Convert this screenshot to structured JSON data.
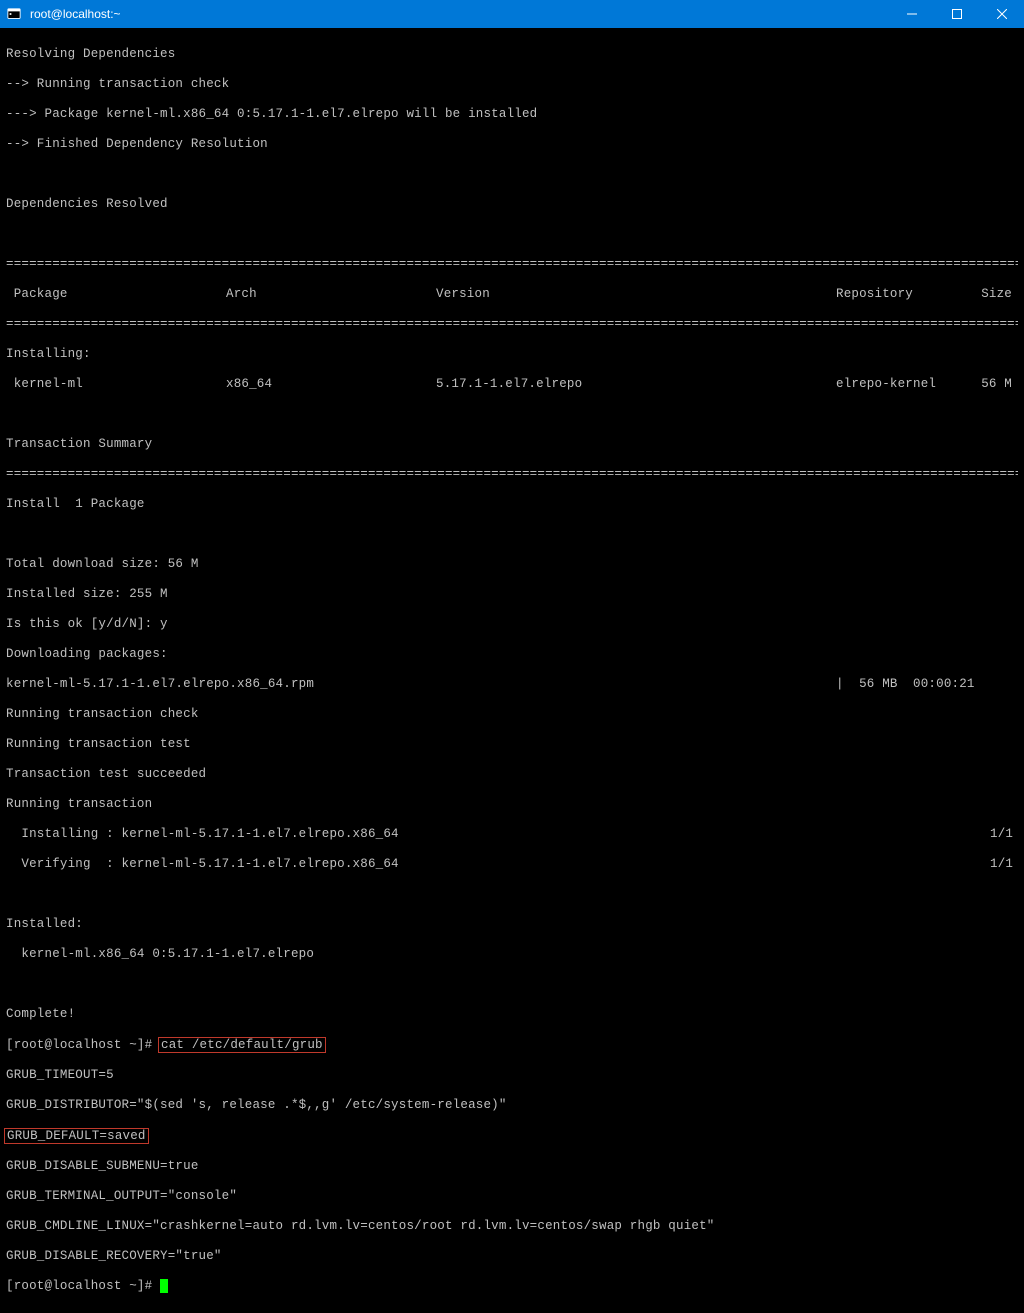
{
  "window": {
    "title": "root@localhost:~"
  },
  "lines": {
    "l1": "Resolving Dependencies",
    "l2": "--> Running transaction check",
    "l3": "---> Package kernel-ml.x86_64 0:5.17.1-1.el7.elrepo will be installed",
    "l4": "--> Finished Dependency Resolution",
    "l5": "",
    "l6": "Dependencies Resolved",
    "l7": "",
    "hdr_pkg": " Package",
    "hdr_arch": "Arch",
    "hdr_ver": "Version",
    "hdr_repo": "Repository",
    "hdr_size": "Size",
    "inst_hdr": "Installing:",
    "row_pkg": " kernel-ml",
    "row_arch": "x86_64",
    "row_ver": "5.17.1-1.el7.elrepo",
    "row_repo": "elrepo-kernel",
    "row_size": "56 M",
    "l8": "Transaction Summary",
    "l9": "Install  1 Package",
    "l10": "",
    "l11": "Total download size: 56 M",
    "l12": "Installed size: 255 M",
    "l13": "Is this ok [y/d/N]: y",
    "l14": "Downloading packages:",
    "l15a": "kernel-ml-5.17.1-1.el7.elrepo.x86_64.rpm",
    "l15b": "|  56 MB  00:00:21",
    "l16": "Running transaction check",
    "l17": "Running transaction test",
    "l18": "Transaction test succeeded",
    "l19": "Running transaction",
    "l20a": "  Installing : kernel-ml-5.17.1-1.el7.elrepo.x86_64",
    "l20b": "1/1",
    "l21a": "  Verifying  : kernel-ml-5.17.1-1.el7.elrepo.x86_64",
    "l21b": "1/1",
    "l22": "",
    "l23": "Installed:",
    "l24": "  kernel-ml.x86_64 0:5.17.1-1.el7.elrepo",
    "l25": "",
    "l26": "Complete!",
    "l27a": "[root@localhost ~]# ",
    "l27b": "cat /etc/default/grub",
    "l28": "GRUB_TIMEOUT=5",
    "l29": "GRUB_DISTRIBUTOR=\"$(sed 's, release .*$,,g' /etc/system-release)\"",
    "l30": "GRUB_DEFAULT=saved",
    "l31": "GRUB_DISABLE_SUBMENU=true",
    "l32": "GRUB_TERMINAL_OUTPUT=\"console\"",
    "l33": "GRUB_CMDLINE_LINUX=\"crashkernel=auto rd.lvm.lv=centos/root rd.lvm.lv=centos/swap rhgb quiet\"",
    "l34": "GRUB_DISABLE_RECOVERY=\"true\"",
    "l35": "[root@localhost ~]# "
  },
  "eq": "============================================================================================================================================================="
}
